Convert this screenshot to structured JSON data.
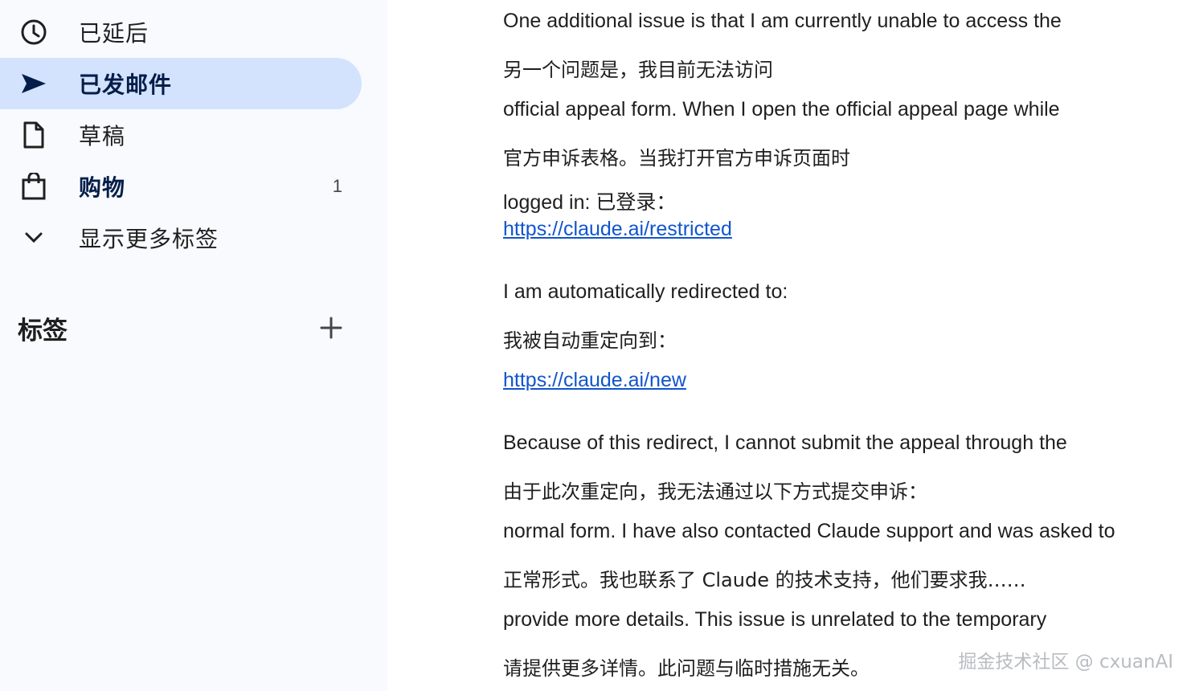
{
  "sidebar": {
    "items": [
      {
        "label": "已延后",
        "icon": "clock-icon"
      },
      {
        "label": "已发邮件",
        "icon": "send-icon"
      },
      {
        "label": "草稿",
        "icon": "draft-icon"
      },
      {
        "label": "购物",
        "icon": "shopping-bag-icon",
        "count": "1"
      },
      {
        "label": "显示更多标签",
        "icon": "chevron-down-icon"
      }
    ],
    "labels_title": "标签",
    "active_color": "#d3e3fd"
  },
  "email": {
    "lines": [
      "One additional issue is that I am currently unable to access the",
      "另一个问题是，我目前无法访问",
      "official appeal form. When I open the official appeal page while",
      "官方申诉表格。当我打开官方申诉页面时",
      "logged in:  已登录："
    ],
    "link1": "https://claude.ai/restricted",
    "lines2": [
      "I am automatically redirected to:",
      "我被自动重定向到："
    ],
    "link2": "https://claude.ai/new",
    "lines3": [
      "Because of this redirect, I cannot submit the appeal through the",
      "由于此次重定向，我无法通过以下方式提交申诉：",
      "normal form. I have also contacted Claude support and was asked to",
      "正常形式。我也联系了 Claude 的技术支持，他们要求我……",
      "provide more details. This issue is unrelated to the temporary",
      "请提供更多详情。此问题与临时措施无关。"
    ],
    "link_color": "#1155cc"
  },
  "watermark": "掘金技术社区 @ cxuanAI"
}
